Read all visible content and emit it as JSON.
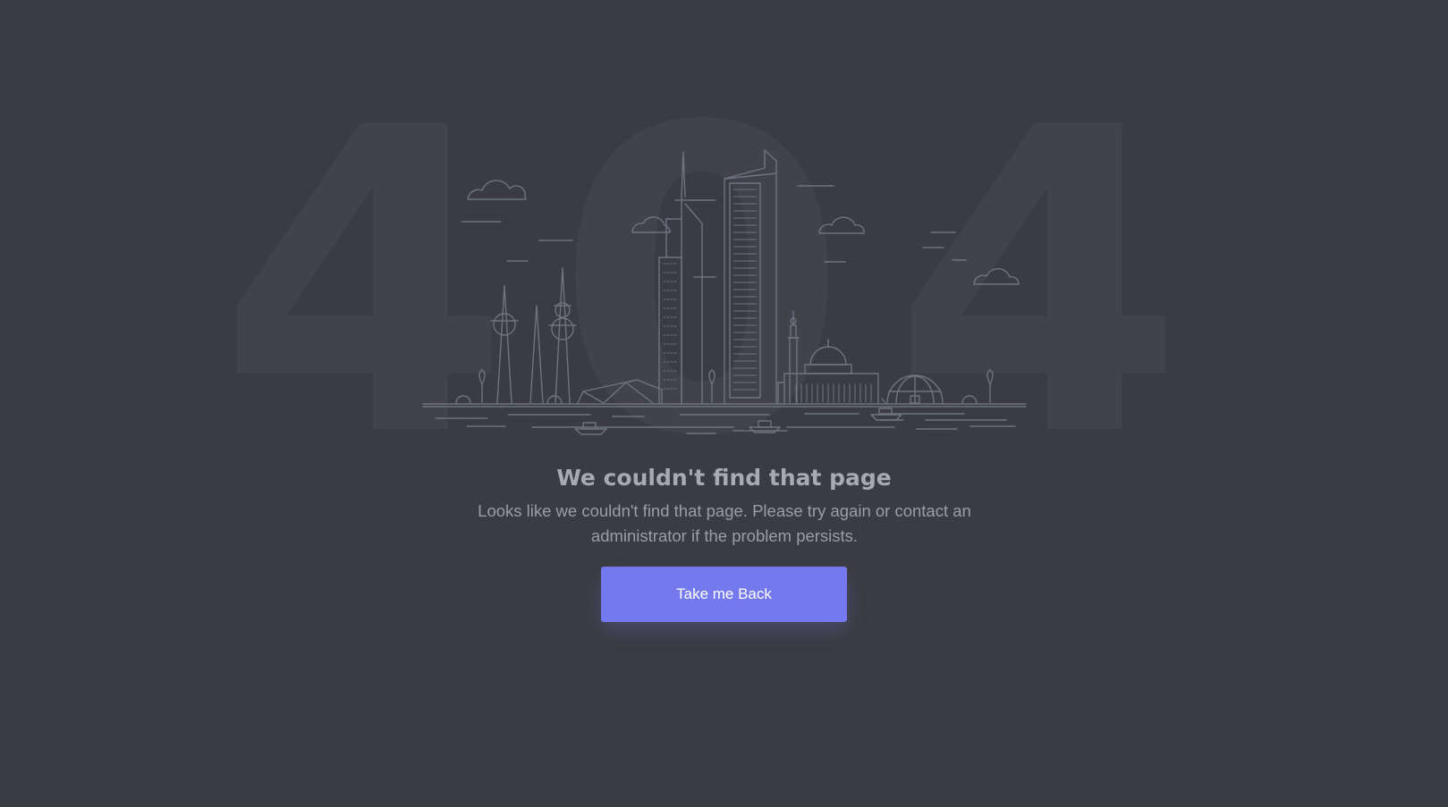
{
  "background_text": "404",
  "error": {
    "title": "We couldn't find that page",
    "message": "Looks like we couldn't find that page. Please try again or contact an administrator if the problem persists."
  },
  "actions": {
    "back_label": "Take me Back"
  },
  "illustration": {
    "icon": "city-skyline-illustration"
  },
  "colors": {
    "background": "#3b3b43",
    "accent": "#7579ee",
    "line_art": "#6d7480",
    "big_number": "#42424b"
  }
}
